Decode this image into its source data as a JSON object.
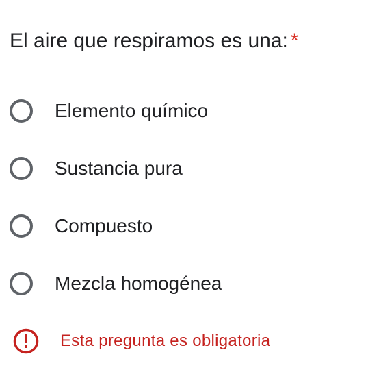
{
  "question": {
    "title": "El aire que respiramos es una:",
    "required_marker": "*"
  },
  "options": [
    {
      "label": "Elemento químico",
      "selected": false
    },
    {
      "label": "Sustancia pura",
      "selected": false
    },
    {
      "label": "Compuesto",
      "selected": false
    },
    {
      "label": "Mezcla homogénea",
      "selected": false
    }
  ],
  "validation": {
    "icon": "error-icon",
    "message": "Esta pregunta es obligatoria"
  },
  "colors": {
    "text": "#202124",
    "radio_border": "#5f6368",
    "required": "#d93025",
    "error": "#c5221f"
  }
}
